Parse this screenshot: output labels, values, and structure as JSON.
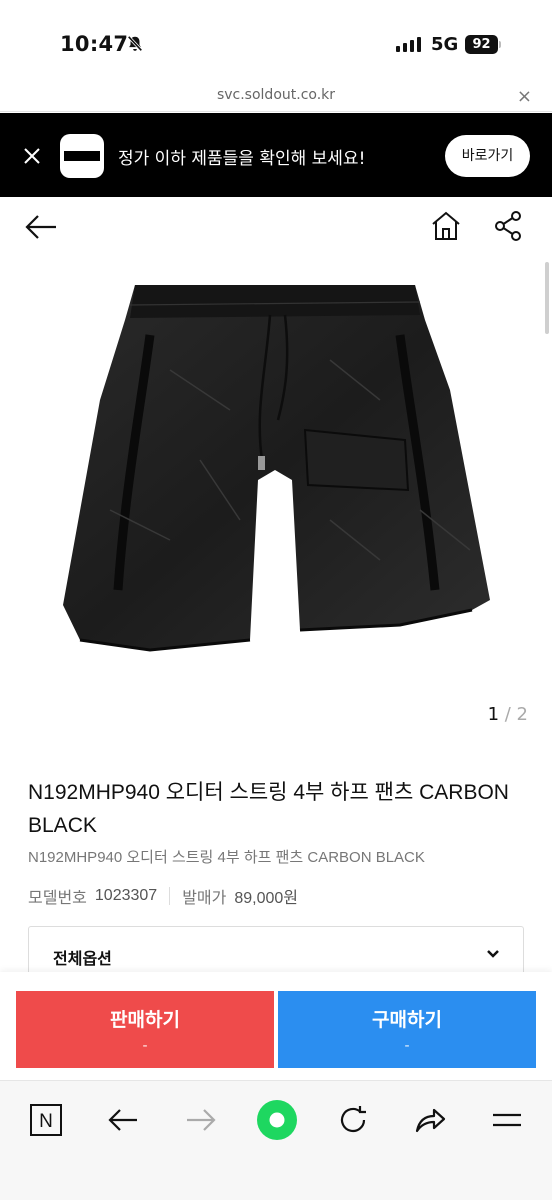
{
  "status_bar": {
    "time": "10:47",
    "network": "5G",
    "battery": "92"
  },
  "browser": {
    "url": "svc.soldout.co.kr",
    "close_label": "×"
  },
  "banner": {
    "text": "정가 이하 제품들을 확인해 보세요!",
    "button_label": "바로가기"
  },
  "gallery": {
    "current": "1",
    "separator": " / ",
    "total": "2"
  },
  "product": {
    "title": "N192MHP940 오디터 스트링 4부 하프 팬츠 CARBON BLACK",
    "subtitle": "N192MHP940 오디터 스트링 4부 하프 팬츠 CARBON BLACK",
    "model_label": "모델번호",
    "model_value": "1023307",
    "price_label": "발매가",
    "price_value": "89,000원"
  },
  "options": {
    "selected": "전체옵션"
  },
  "actions": {
    "sell_label": "판매하기",
    "sell_price": "-",
    "buy_label": "구매하기",
    "buy_price": "-"
  },
  "colors": {
    "sell": "#ef4b4b",
    "buy": "#2b8ef0",
    "banner_bg": "#000000",
    "home_green": "#1ed760"
  },
  "toolbar": {
    "naver_label": "N"
  }
}
